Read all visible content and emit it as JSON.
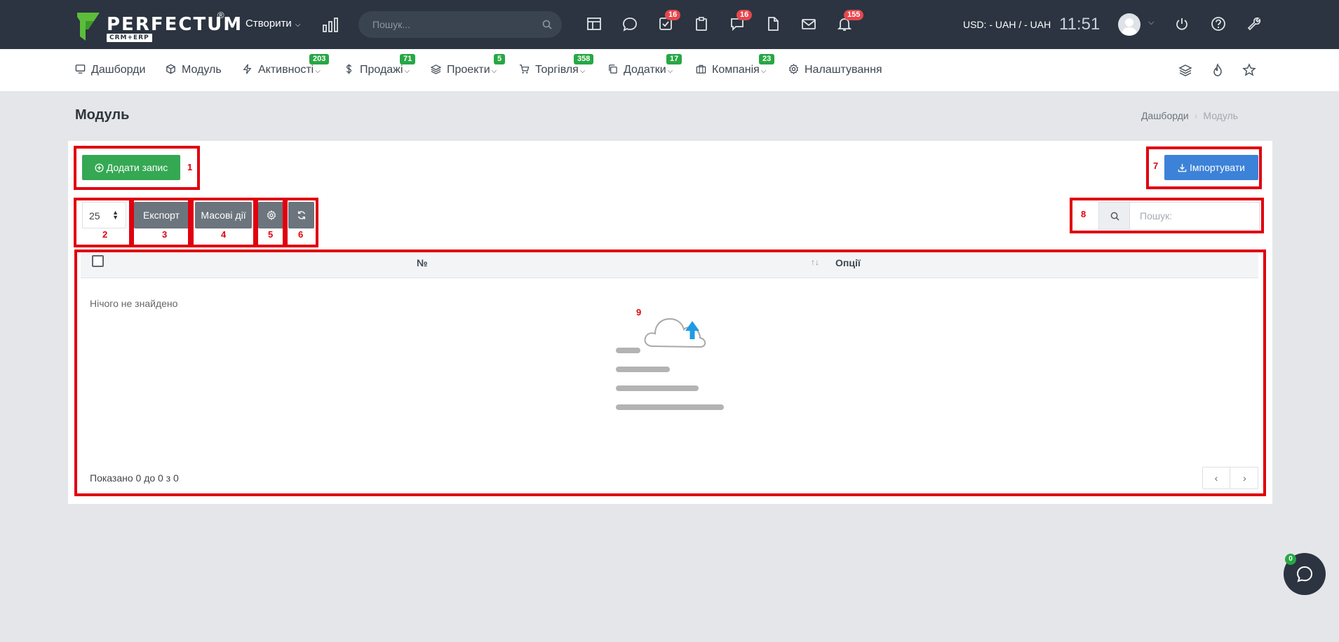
{
  "app": {
    "logo_text": "PERFECTUM",
    "logo_sub": "CRM+ERP",
    "logo_reg": "®",
    "create_label": "Створити",
    "search_placeholder": "Пошук...",
    "badges": {
      "tasks": "16",
      "chat": "16",
      "notifications": "155"
    },
    "currency": "USD: - UAH / - UAH",
    "time": "11:51"
  },
  "nav": {
    "items": [
      {
        "label": "Дашборди",
        "icon": "dashboard-icon"
      },
      {
        "label": "Модуль",
        "icon": "cube-icon"
      },
      {
        "label": "Активності",
        "icon": "bolt-icon",
        "badge": "203"
      },
      {
        "label": "Продажі",
        "icon": "dollar-icon",
        "badge": "71"
      },
      {
        "label": "Проекти",
        "icon": "layers-icon",
        "badge": "5"
      },
      {
        "label": "Торгівля",
        "icon": "cart-icon",
        "badge": "358"
      },
      {
        "label": "Додатки",
        "icon": "copy-icon",
        "badge": "17"
      },
      {
        "label": "Компанія",
        "icon": "briefcase-icon",
        "badge": "23"
      },
      {
        "label": "Налаштування",
        "icon": "gear-icon"
      }
    ]
  },
  "page": {
    "title": "Модуль",
    "breadcrumb": [
      "Дашборди",
      "Модуль"
    ]
  },
  "toolbar": {
    "add_label": "Додати запис",
    "import_label": "Імпортувати",
    "page_size": "25",
    "export_label": "Експорт",
    "bulk_label": "Масові дії",
    "search_placeholder": "Пошук:"
  },
  "annotations": [
    "1",
    "2",
    "3",
    "4",
    "5",
    "6",
    "7",
    "8",
    "9"
  ],
  "table": {
    "columns": [
      "№",
      "Опції"
    ],
    "empty_text": "Нічого не знайдено",
    "info": "Показано 0 до 0 з 0"
  },
  "chat": {
    "badge": "0"
  },
  "colors": {
    "topbar": "#2b3440",
    "accent_green": "#34a853",
    "accent_blue": "#3c82d8",
    "annotation_red": "#e0000f",
    "badge_red": "#e5474d",
    "badge_green": "#28a745"
  }
}
